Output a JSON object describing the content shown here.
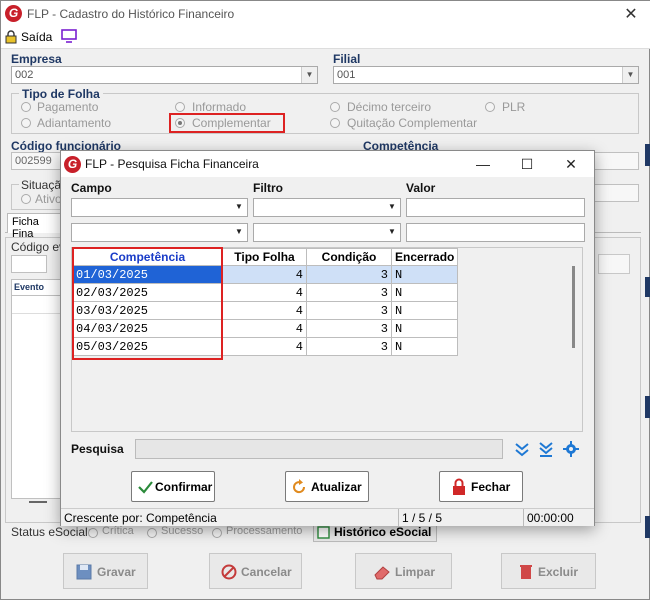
{
  "main": {
    "title": "FLP - Cadastro do Histórico Financeiro",
    "toolbar": {
      "exit_label": "Saída"
    },
    "empresa": {
      "label": "Empresa",
      "value": "002"
    },
    "filial": {
      "label": "Filial",
      "value": "001"
    },
    "tipo_folha": {
      "label": "Tipo de Folha",
      "options": [
        "Pagamento",
        "Adiantamento",
        "Informado",
        "Complementar",
        "Décimo terceiro",
        "Quitação Complementar",
        "PLR"
      ],
      "selected": "Complementar"
    },
    "codigo_funcionario": {
      "label": "Código funcionário",
      "value": "002599"
    },
    "competencia_label": "Competência",
    "situacao": {
      "label": "Situaçã",
      "option": "Ativo"
    },
    "tab_label": "Ficha Fina",
    "codigo_evento_label": "Código eve",
    "evento_col": "Evento",
    "status_esocial": {
      "label": "Status eSocial:",
      "options": [
        "Crítica",
        "Sucesso",
        "Processamento"
      ],
      "button": "Histórico eSocial"
    },
    "buttons": {
      "gravar": "Gravar",
      "cancelar": "Cancelar",
      "limpar": "Limpar",
      "excluir": "Excluir"
    },
    "colors": {
      "label": "#1f3864",
      "highlight": "#d22222"
    }
  },
  "dialog": {
    "title": "FLP - Pesquisa Ficha Financeira",
    "filters": {
      "campo_label": "Campo",
      "filtro_label": "Filtro",
      "valor_label": "Valor"
    },
    "table": {
      "headers": [
        "Competência",
        "Tipo Folha",
        "Condição",
        "Encerrado"
      ],
      "rows": [
        [
          "01/03/2025",
          "4",
          "3",
          "N"
        ],
        [
          "02/03/2025",
          "4",
          "3",
          "N"
        ],
        [
          "03/03/2025",
          "4",
          "3",
          "N"
        ],
        [
          "04/03/2025",
          "4",
          "3",
          "N"
        ],
        [
          "05/03/2025",
          "4",
          "3",
          "N"
        ]
      ],
      "selected_row": 0
    },
    "pesquisa_label": "Pesquisa",
    "buttons": {
      "confirmar": "Confirmar",
      "atualizar": "Atualizar",
      "fechar": "Fechar"
    },
    "status": {
      "sort": "Crescente por: Competência",
      "position": "1 / 5 / 5",
      "time": "00:00:00"
    }
  }
}
